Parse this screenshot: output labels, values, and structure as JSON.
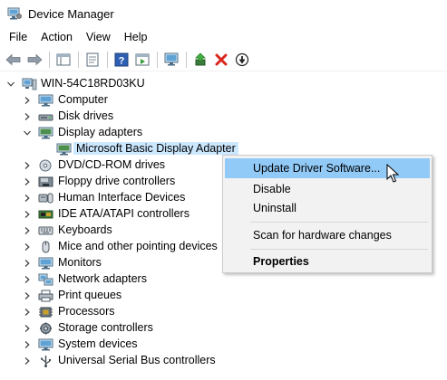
{
  "window": {
    "title": "Device Manager"
  },
  "menu": [
    "File",
    "Action",
    "View",
    "Help"
  ],
  "toolbar": {
    "buttons": [
      "back-arrow-icon",
      "forward-arrow-icon",
      "tree-view-icon",
      "properties-icon",
      "help-icon",
      "action-pane-icon",
      "scan-hardware-icon",
      "update-driver-icon",
      "uninstall-x-icon",
      "disable-device-icon"
    ]
  },
  "tree": {
    "root": "WIN-54C18RD03KU",
    "categories": [
      {
        "label": "Computer",
        "icon": "computer-icon",
        "expanded": false
      },
      {
        "label": "Disk drives",
        "icon": "disk-drive-icon",
        "expanded": false
      },
      {
        "label": "Display adapters",
        "icon": "display-adapter-icon",
        "expanded": true,
        "children": [
          "Microsoft Basic Display Adapter"
        ]
      },
      {
        "label": "DVD/CD-ROM drives",
        "icon": "dvd-drive-icon",
        "expanded": false
      },
      {
        "label": "Floppy drive controllers",
        "icon": "floppy-controller-icon",
        "expanded": false
      },
      {
        "label": "Human Interface Devices",
        "icon": "hid-icon",
        "expanded": false
      },
      {
        "label": "IDE ATA/ATAPI controllers",
        "icon": "ide-controller-icon",
        "expanded": false
      },
      {
        "label": "Keyboards",
        "icon": "keyboard-icon",
        "expanded": false
      },
      {
        "label": "Mice and other pointing devices",
        "icon": "mouse-icon",
        "expanded": false
      },
      {
        "label": "Monitors",
        "icon": "monitor-icon",
        "expanded": false
      },
      {
        "label": "Network adapters",
        "icon": "network-adapter-icon",
        "expanded": false
      },
      {
        "label": "Print queues",
        "icon": "print-queue-icon",
        "expanded": false
      },
      {
        "label": "Processors",
        "icon": "processor-icon",
        "expanded": false
      },
      {
        "label": "Storage controllers",
        "icon": "storage-controller-icon",
        "expanded": false
      },
      {
        "label": "System devices",
        "icon": "system-devices-icon",
        "expanded": false
      },
      {
        "label": "Universal Serial Bus controllers",
        "icon": "usb-controller-icon",
        "expanded": false
      }
    ]
  },
  "context_menu": {
    "items": [
      "Update Driver Software...",
      "Disable",
      "Uninstall",
      "Scan for hardware changes",
      "Properties"
    ],
    "highlighted": "Update Driver Software...",
    "default_item": "Properties"
  },
  "colors": {
    "selection": "#cce8ff",
    "menu_hover": "#91c9f7",
    "menu_bg": "#f2f2f2"
  }
}
